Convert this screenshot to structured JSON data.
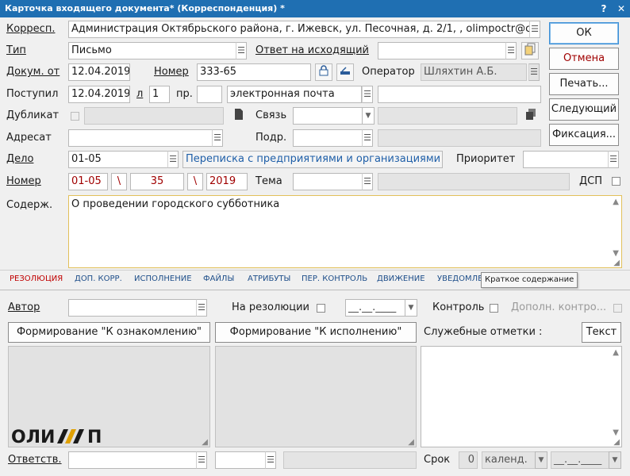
{
  "window": {
    "title": "Карточка входящего документа* (Корреспонденция) *",
    "help_label": "?",
    "close_label": "✕"
  },
  "fields": {
    "korresp": {
      "label": "Корресп.",
      "value": "Администрация Октябрьского района, г. Ижевск, ул. Песочная,  д. 2/1, , olimpoctr@c"
    },
    "tip": {
      "label": "Тип",
      "value": "Письмо"
    },
    "otvet": {
      "label": "Ответ на исходящий",
      "value": ""
    },
    "dokum_ot": {
      "label": "Докум. от",
      "value": "12.04.2019"
    },
    "nomer": {
      "label": "Номер",
      "value": "333-65"
    },
    "operator": {
      "label": "Оператор",
      "value": "Шляхтин А.Б."
    },
    "postupil": {
      "label": "Поступил",
      "date": "12.04.2019",
      "l_label": "л",
      "l_value": "1",
      "pr_label": "пр.",
      "pr_value": "",
      "channel": "электронная почта",
      "extra": ""
    },
    "dublikat": {
      "label": "Дубликат",
      "value": ""
    },
    "svyaz": {
      "label": "Связь",
      "value": "",
      "extra": ""
    },
    "adresat": {
      "label": "Адресат",
      "value": ""
    },
    "podr": {
      "label": "Подр.",
      "value": "",
      "extra": ""
    },
    "delo": {
      "label": "Дело",
      "value": "01-05",
      "link": "Переписка с предприятиями и организациями"
    },
    "prioritet": {
      "label": "Приоритет",
      "value": ""
    },
    "nomer2": {
      "label": "Номер",
      "part1": "01-05",
      "sep": "\\",
      "part2": "35",
      "part3": "2019"
    },
    "tema": {
      "label": "Тема",
      "value": "",
      "extra": ""
    },
    "dsp": {
      "label": "ДСП"
    },
    "soderzh": {
      "label": "Содерж.",
      "value": "О проведении городского субботника"
    }
  },
  "buttons": {
    "ok": "ОК",
    "cancel": "Отмена",
    "print": "Печать...",
    "next": "Следующий",
    "fix": "Фиксация..."
  },
  "tabs": [
    {
      "label": "РЕЗОЛЮЦИЯ",
      "active": true
    },
    {
      "label": "ДОП. КОРР.",
      "active": false
    },
    {
      "label": "ИСПОЛНЕНИЕ",
      "active": false
    },
    {
      "label": "ФАЙЛЫ",
      "active": false
    },
    {
      "label": "АТРИБУТЫ",
      "active": false
    },
    {
      "label": "ПЕР. КОНТРОЛЬ",
      "active": false
    },
    {
      "label": "ДВИЖЕНИЕ",
      "active": false
    },
    {
      "label": "УВЕДОМЛЕ",
      "active": false
    }
  ],
  "tooltip": "Краткое содержание",
  "resolution": {
    "avtor_label": "Автор",
    "avtor_value": "",
    "na_rez_label": "На резолюции",
    "date_placeholder": "__.__.____",
    "kontrol_label": "Контроль",
    "dop_kontrol_label": "Дополн. контро...",
    "form_oznak": "Формирование \"К ознакомлению\"",
    "form_ispoln": "Формирование \"К исполнению\"",
    "sluzh_label": "Служебные отметки :",
    "text_btn": "Текст",
    "otvetstv_label": "Ответств.",
    "srok_label": "Срок",
    "srok_value": "0",
    "calendar_value": "календ.",
    "srok_date": "__.__.____"
  },
  "logo": {
    "text": "ОЛИМП",
    "colors": {
      "dark": "#1a1a1a",
      "accent": "#e0a000"
    }
  }
}
